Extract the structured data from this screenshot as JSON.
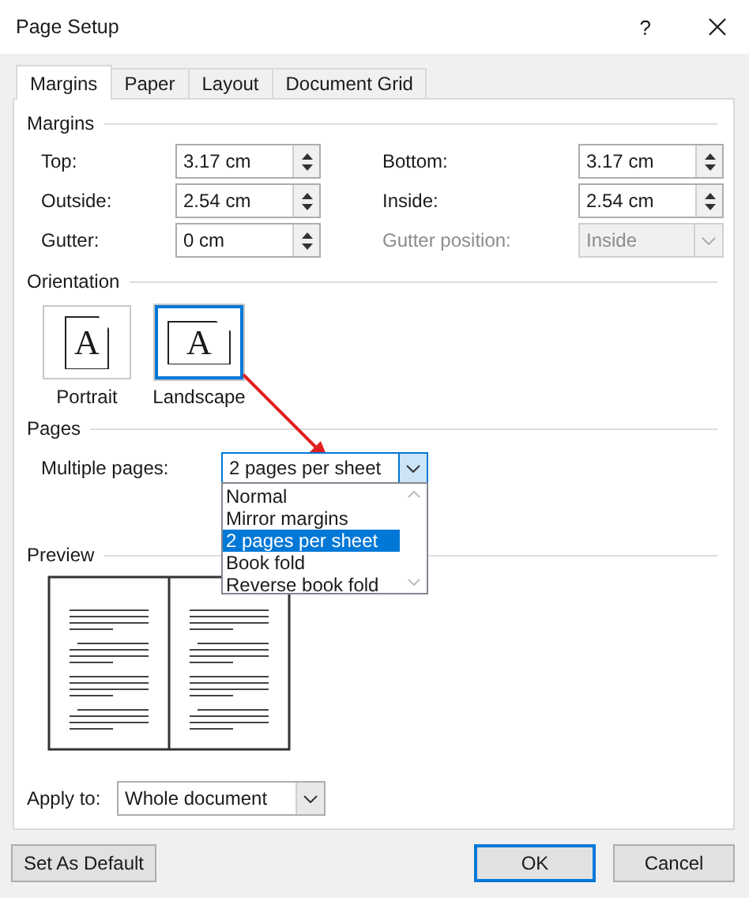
{
  "window": {
    "title": "Page Setup",
    "help": "?"
  },
  "tabs": [
    {
      "label": "Margins",
      "selected": true
    },
    {
      "label": "Paper",
      "selected": false
    },
    {
      "label": "Layout",
      "selected": false
    },
    {
      "label": "Document Grid",
      "selected": false
    }
  ],
  "margins": {
    "title": "Margins",
    "fields": [
      {
        "label": "Top:",
        "value": "3.17 cm",
        "kind": "spin",
        "disabled": false
      },
      {
        "label": "Bottom:",
        "value": "3.17 cm",
        "kind": "spin",
        "disabled": false
      },
      {
        "label": "Outside:",
        "value": "2.54 cm",
        "kind": "spin",
        "disabled": false
      },
      {
        "label": "Inside:",
        "value": "2.54 cm",
        "kind": "spin",
        "disabled": false
      },
      {
        "label": "Gutter:",
        "value": "0 cm",
        "kind": "spin",
        "disabled": false
      },
      {
        "label": "Gutter position:",
        "value": "Inside",
        "kind": "select",
        "disabled": true
      }
    ]
  },
  "orientation": {
    "title": "Orientation",
    "options": [
      {
        "label": "Portrait",
        "glyph": "A",
        "kind": "portrait",
        "selected": false
      },
      {
        "label": "Landscape",
        "glyph": "A",
        "kind": "landscape",
        "selected": true
      }
    ]
  },
  "pages": {
    "title": "Pages",
    "multiple_pages": {
      "label": "Multiple pages:",
      "value": "2 pages per sheet",
      "expanded": true,
      "options": [
        {
          "label": "Normal",
          "selected": false
        },
        {
          "label": "Mirror margins",
          "selected": false
        },
        {
          "label": "2 pages per sheet",
          "selected": true
        },
        {
          "label": "Book fold",
          "selected": false
        },
        {
          "label": "Reverse book fold",
          "selected": false
        }
      ]
    }
  },
  "preview": {
    "title": "Preview"
  },
  "apply_to": {
    "label": "Apply to:",
    "value": "Whole document"
  },
  "buttons": [
    {
      "label": "Set As Default",
      "default": false
    },
    {
      "label": "OK",
      "default": true
    },
    {
      "label": "Cancel",
      "default": false
    }
  ]
}
